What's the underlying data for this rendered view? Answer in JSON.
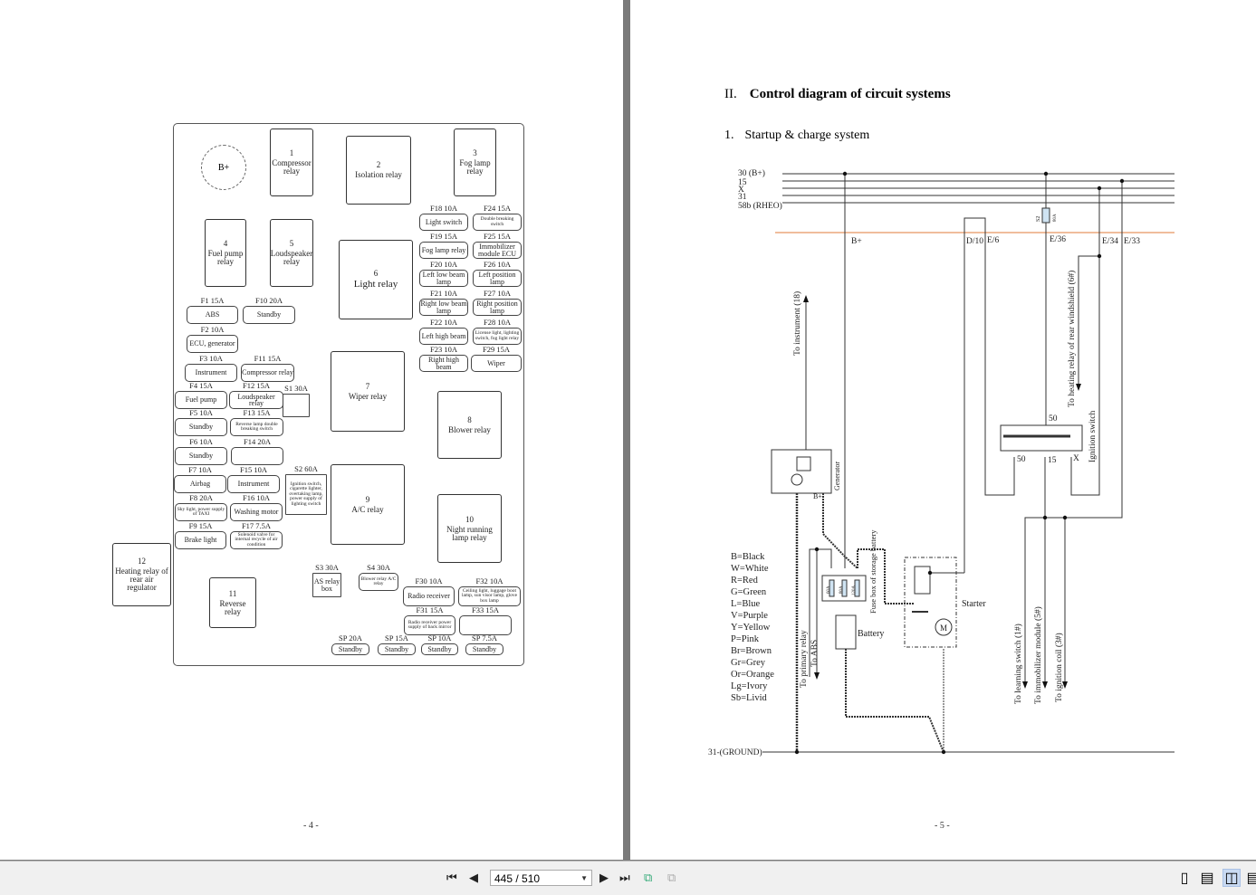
{
  "left_page": {
    "fuse_box": {
      "b_plus": "B+",
      "relays": [
        {
          "num": "1",
          "label": "Compressor relay"
        },
        {
          "num": "2",
          "label": "Isolation relay"
        },
        {
          "num": "3",
          "label": "Fog lamp relay"
        },
        {
          "num": "4",
          "label": "Fuel pump relay"
        },
        {
          "num": "5",
          "label": "Loudspeaker relay"
        },
        {
          "num": "6",
          "label": "Light relay"
        },
        {
          "num": "7",
          "label": "Wiper relay"
        },
        {
          "num": "8",
          "label": "Blower relay"
        },
        {
          "num": "9",
          "label": "A/C relay"
        },
        {
          "num": "10",
          "label": "Night running lamp relay"
        },
        {
          "num": "11",
          "label": "Reverse relay"
        },
        {
          "num": "12",
          "label": "Heating relay of rear air regulator"
        }
      ],
      "fuses": [
        {
          "rating": "F1 15A",
          "label": "ABS"
        },
        {
          "rating": "F10 20A",
          "label": "Standby"
        },
        {
          "rating": "F2 10A",
          "label": "ECU, generator"
        },
        {
          "rating": "F3 10A",
          "label": "Instrument"
        },
        {
          "rating": "F11 15A",
          "label": "Compressor relay"
        },
        {
          "rating": "F4 15A",
          "label": "Fuel pump"
        },
        {
          "rating": "F12 15A",
          "label": "Loudspeaker relay"
        },
        {
          "rating": "S1 30A",
          "label": ""
        },
        {
          "rating": "F5 10A",
          "label": "Standby"
        },
        {
          "rating": "F13 15A",
          "label": "Reverse lamp double breaking switch"
        },
        {
          "rating": "F6 10A",
          "label": "Standby"
        },
        {
          "rating": "F14 20A",
          "label": ""
        },
        {
          "rating": "F7 10A",
          "label": "Airbag"
        },
        {
          "rating": "F15 10A",
          "label": "Instrument"
        },
        {
          "rating": "S2 60A",
          "label": "Ignition switch, cigarette lighter, overtaking lamp, power supply of lighting switch"
        },
        {
          "rating": "F8 20A",
          "label": "Sky light, power supply of TAXI"
        },
        {
          "rating": "F16 10A",
          "label": "Washing motor"
        },
        {
          "rating": "F9 15A",
          "label": "Brake light"
        },
        {
          "rating": "F17 7.5A",
          "label": "Solenoid valve for internal recycle of air condition"
        },
        {
          "rating": "F18 10A",
          "label": "Light switch"
        },
        {
          "rating": "F24 15A",
          "label": "Double breaking switch"
        },
        {
          "rating": "F19 15A",
          "label": "Fog lamp relay"
        },
        {
          "rating": "F25 15A",
          "label": "Immobilizer module ECU"
        },
        {
          "rating": "F20 10A",
          "label": "Left low beam lamp"
        },
        {
          "rating": "F26 10A",
          "label": "Left position lamp"
        },
        {
          "rating": "F21 10A",
          "label": "Right low beam lamp"
        },
        {
          "rating": "F27 10A",
          "label": "Right position lamp"
        },
        {
          "rating": "F22 10A",
          "label": "Left high beam"
        },
        {
          "rating": "F28 10A",
          "label": "License light, lighting switch, fog light relay"
        },
        {
          "rating": "F23 10A",
          "label": "Right high beam"
        },
        {
          "rating": "F29 15A",
          "label": "Wiper"
        },
        {
          "rating": "S3 30A",
          "label": "AS relay box"
        },
        {
          "rating": "S4 30A",
          "label": "Blower relay A/C relay"
        },
        {
          "rating": "F30 10A",
          "label": "Radio receiver"
        },
        {
          "rating": "F32 10A",
          "label": "Ceiling light, luggage boot lamp, sun visor lamp, glove box lamp"
        },
        {
          "rating": "F31 15A",
          "label": "Radio receiver power supply of back mirror"
        },
        {
          "rating": "F33 15A",
          "label": ""
        },
        {
          "rating": "SP 20A",
          "label": "Standby"
        },
        {
          "rating": "SP 15A",
          "label": "Standby"
        },
        {
          "rating": "SP 10A",
          "label": "Standby"
        },
        {
          "rating": "SP 7.5A",
          "label": "Standby"
        }
      ]
    },
    "page_number": "- 4 -"
  },
  "right_page": {
    "section_num": "II.",
    "section_title": "Control diagram of circuit systems",
    "subsection_num": "1.",
    "subsection_title": "Startup & charge system",
    "diagram": {
      "bus_labels": [
        "30 (B+)",
        "15",
        "X",
        "31",
        "58b (RHEO)"
      ],
      "connectors": [
        "B+",
        "D/10",
        "E/6",
        "E/36",
        "E/34",
        "E/33"
      ],
      "fuse_s2": "S2",
      "fuse_s2_rating": "80A",
      "switch_terminals": [
        "50",
        "50",
        "15",
        "X"
      ],
      "ignition_switch": "Ignition switch",
      "to_instrument": "To instrument (18)",
      "to_heating_relay": "To heating relay of rear windshield (6#)",
      "generator": "Generator",
      "generator_bplus": "B+",
      "to_primary_relay": "To primary relay",
      "to_abs": "To ABS",
      "battery_fuse_ratings": [
        "60A",
        "80A",
        "120A"
      ],
      "fuse_box_battery": "Fuse box of storage battery",
      "battery": "Battery",
      "starter": "Starter",
      "motor": "M",
      "to_learning_switch": "To learning switch (1#)",
      "to_immobilizer": "To immobilizer module (5#)",
      "to_ignition_coil": "To ignition coil (3#)",
      "ground": "31-(GROUND)",
      "harness_line_color": "#e07b39"
    },
    "color_codes": [
      "B=Black",
      "W=White",
      "R=Red",
      "G=Green",
      "L=Blue",
      "V=Purple",
      "Y=Yellow",
      "P=Pink",
      "Br=Brown",
      "Gr=Grey",
      "Or=Orange",
      "Lg=Ivory",
      "Sb=Livid"
    ],
    "page_number": "- 5 -"
  },
  "toolbar": {
    "page_value": "445 / 510",
    "active_view": "two-page"
  }
}
